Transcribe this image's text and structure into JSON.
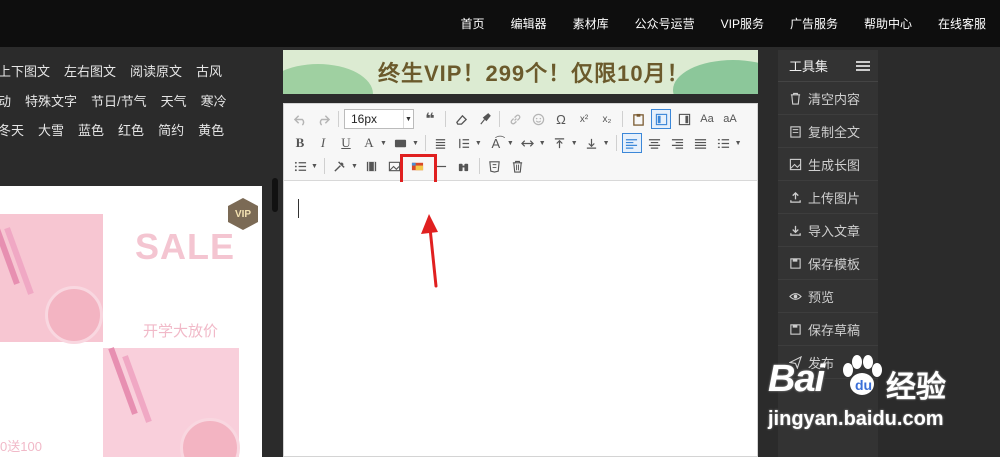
{
  "topnav": {
    "items": [
      "首页",
      "编辑器",
      "素材库",
      "公众号运营",
      "VIP服务",
      "广告服务",
      "帮助中心",
      "在线客服"
    ]
  },
  "tags": {
    "row1": [
      "上下图文",
      "左右图文",
      "阅读原文",
      "古风"
    ],
    "row2": [
      "动",
      "特殊文字",
      "节日/节气",
      "天气",
      "寒冷"
    ],
    "row3": [
      "冬天",
      "大雪",
      "蓝色",
      "红色",
      "简约",
      "黄色"
    ]
  },
  "preview": {
    "sale": "SALE",
    "subtitle": "开学大放价",
    "bottom": "0送100",
    "vip_badge": "VIP"
  },
  "banner": {
    "text": "终生VIP！299个！仅限10月！"
  },
  "editor": {
    "font_size": "16px",
    "icons": {
      "undo": "undo-icon",
      "redo": "redo-icon",
      "quote": "quote-icon",
      "eraser": "eraser-icon",
      "format_brush": "format-brush-icon",
      "link": "link-icon",
      "emoji": "emoji-icon",
      "omega": "special-char-icon",
      "superscript": "superscript-icon",
      "subscript": "subscript-icon",
      "image_insert": "insert-image-icon"
    },
    "labels": {
      "bold": "B",
      "italic": "I",
      "underline": "U",
      "font_color": "A",
      "superscript": "x²",
      "subscript": "x₂",
      "omega": "Ω"
    }
  },
  "tools": {
    "title": "工具集",
    "items": [
      {
        "label": "清空内容",
        "icon": "trash-icon"
      },
      {
        "label": "复制全文",
        "icon": "copy-icon"
      },
      {
        "label": "生成长图",
        "icon": "image-icon"
      },
      {
        "label": "上传图片",
        "icon": "upload-icon"
      },
      {
        "label": "导入文章",
        "icon": "import-icon"
      },
      {
        "label": "保存模板",
        "icon": "save-icon"
      },
      {
        "label": "预览",
        "icon": "eye-icon"
      },
      {
        "label": "保存草稿",
        "icon": "save-icon"
      },
      {
        "label": "发布",
        "icon": "send-icon"
      }
    ]
  },
  "watermark": {
    "brand_left": "Bai",
    "brand_right": "经验",
    "url": "jingyan.baidu.com"
  },
  "colors": {
    "topbar": "#0e0e0e",
    "background": "#2b2b2b",
    "accent_blue": "#3b87d8",
    "highlight_red": "#e02020",
    "pink": "#f7c6d2"
  }
}
